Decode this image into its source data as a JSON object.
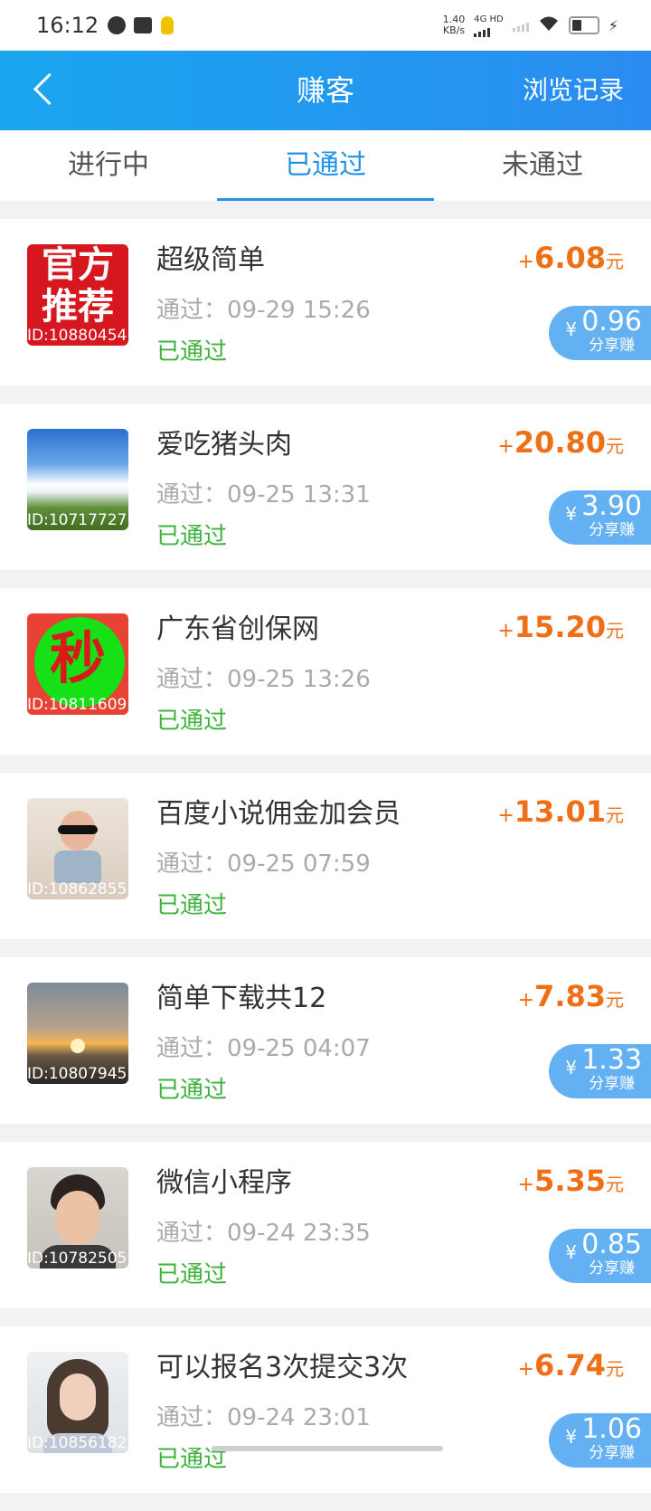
{
  "status_bar": {
    "time": "16:12",
    "speed_value": "1.40",
    "speed_unit": "KB/s",
    "network_type": "4G HD"
  },
  "header": {
    "title": "赚客",
    "history_label": "浏览记录"
  },
  "tabs": [
    {
      "label": "进行中",
      "active": false
    },
    {
      "label": "已通过",
      "active": true
    },
    {
      "label": "未通过",
      "active": false
    }
  ],
  "items": [
    {
      "name": "超级简单",
      "time": "通过：09-29 15:26",
      "status": "已通过",
      "plus": "+",
      "amount": "6.08",
      "unit": "元",
      "thumb_id": "ID:10880454",
      "thumb_text_1": "官方",
      "thumb_text_2": "推荐",
      "share_currency": "¥",
      "share_value": "0.96",
      "share_label": "分享赚"
    },
    {
      "name": "爱吃猪头肉",
      "time": "通过：09-25 13:31",
      "status": "已通过",
      "plus": "+",
      "amount": "20.80",
      "unit": "元",
      "thumb_id": "ID:10717727",
      "share_currency": "¥",
      "share_value": "3.90",
      "share_label": "分享赚"
    },
    {
      "name": "广东省创保网",
      "time": "通过：09-25 13:26",
      "status": "已通过",
      "plus": "+",
      "amount": "15.20",
      "unit": "元",
      "thumb_id": "ID:10811609",
      "thumb_char": "秒"
    },
    {
      "name": "百度小说佣金加会员",
      "time": "通过：09-25 07:59",
      "status": "已通过",
      "plus": "+",
      "amount": "13.01",
      "unit": "元",
      "thumb_id": "ID:10862855"
    },
    {
      "name": "简单下载共12",
      "time": "通过：09-25 04:07",
      "status": "已通过",
      "plus": "+",
      "amount": "7.83",
      "unit": "元",
      "thumb_id": "ID:10807945",
      "share_currency": "¥",
      "share_value": "1.33",
      "share_label": "分享赚"
    },
    {
      "name": "微信小程序",
      "time": "通过：09-24 23:35",
      "status": "已通过",
      "plus": "+",
      "amount": "5.35",
      "unit": "元",
      "thumb_id": "ID:10782505",
      "share_currency": "¥",
      "share_value": "0.85",
      "share_label": "分享赚"
    },
    {
      "name": "可以报名3次提交3次",
      "time": "通过：09-24 23:01",
      "status": "已通过",
      "plus": "+",
      "amount": "6.74",
      "unit": "元",
      "thumb_id": "ID:10856182",
      "share_currency": "¥",
      "share_value": "1.06",
      "share_label": "分享赚"
    }
  ]
}
